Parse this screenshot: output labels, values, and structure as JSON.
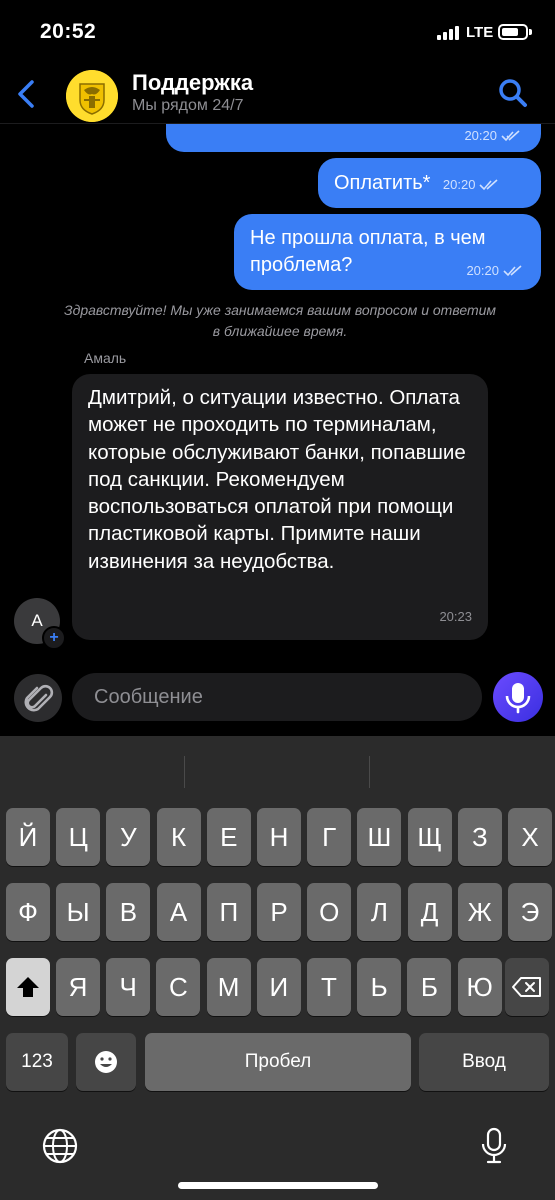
{
  "status_bar": {
    "time": "20:52",
    "network": "LTE"
  },
  "header": {
    "title": "Поддержка",
    "subtitle": "Мы рядом 24/7"
  },
  "messages": {
    "top_partial": {
      "time": "20:20"
    },
    "pay": {
      "text": "Оплатить*",
      "time": "20:20"
    },
    "question": {
      "text": "Не прошла оплата, в чем проблема?",
      "time": "20:20"
    },
    "system": "Здравствуйте! Мы уже занимаемся вашим вопросом и ответим в ближайшее время.",
    "agent_name": "Амаль",
    "agent_initial": "А",
    "agent_reply": {
      "text": "Дмитрий, о ситуации  известно. Оплата может не проходить по терминалам, которые обслуживают банки, попавшие под санкции. Рекомендуем воспользоваться оплатой при помощи пластиковой карты. Примите наши извинения за неудобства.",
      "time": "20:23"
    }
  },
  "composer": {
    "placeholder": "Сообщение"
  },
  "keyboard": {
    "row1": [
      "Й",
      "Ц",
      "У",
      "К",
      "Е",
      "Н",
      "Г",
      "Ш",
      "Щ",
      "З",
      "Х"
    ],
    "row2": [
      "Ф",
      "Ы",
      "В",
      "А",
      "П",
      "Р",
      "О",
      "Л",
      "Д",
      "Ж",
      "Э"
    ],
    "row3": [
      "Я",
      "Ч",
      "С",
      "М",
      "И",
      "Т",
      "Ь",
      "Б",
      "Ю"
    ],
    "numbers_label": "123",
    "space_label": "Пробел",
    "return_label": "Ввод"
  },
  "colors": {
    "accent": "#3a7ef5",
    "bubble_in": "#1c1c1e",
    "brand_yellow": "#ffdd2d"
  }
}
